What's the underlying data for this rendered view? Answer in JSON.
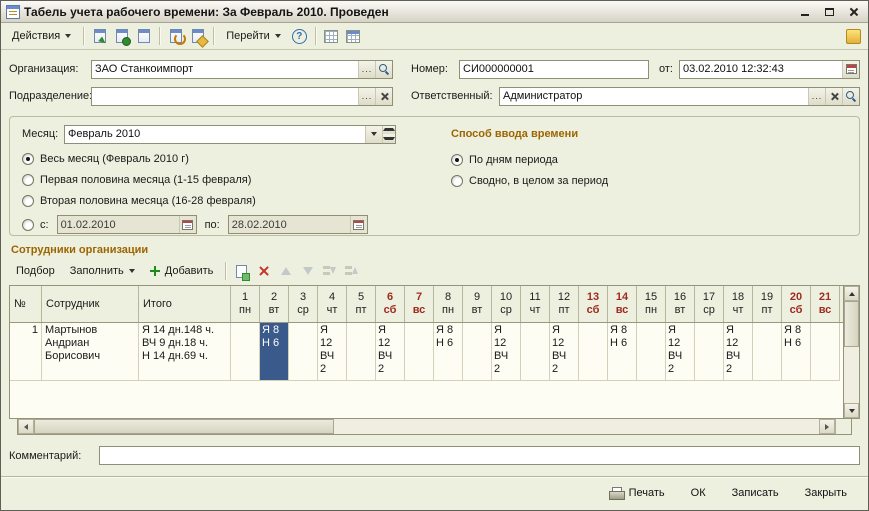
{
  "window": {
    "title": "Табель учета рабочего времени: За Февраль 2010. Проведен"
  },
  "toolbar": {
    "actions_label": "Действия",
    "go_label": "Перейти"
  },
  "glyphs": {
    "help": "?"
  },
  "ui": {
    "ellipsis": "..."
  },
  "fields": {
    "org": {
      "label": "Организация:",
      "value": "ЗАО Станкоимпорт"
    },
    "dept": {
      "label": "Подразделение:",
      "value": ""
    },
    "number": {
      "label": "Номер:",
      "value": "СИ000000001"
    },
    "date": {
      "label": "от:",
      "value": "03.02.2010 12:32:43"
    },
    "responsible": {
      "label": "Ответственный:",
      "value": "Администратор"
    }
  },
  "period": {
    "month": {
      "label": "Месяц:",
      "value": "Февраль 2010"
    },
    "options": [
      {
        "label": "Весь месяц (Февраль 2010 г)",
        "selected": true
      },
      {
        "label": "Первая половина месяца (1-15 февраля)",
        "selected": false
      },
      {
        "label": "Вторая половина месяца (16-28 февраля)",
        "selected": false
      }
    ],
    "range": {
      "from_label": "с:",
      "from_value": "01.02.2010",
      "to_label": "по:",
      "to_value": "28.02.2010",
      "selected": false
    }
  },
  "time_entry": {
    "header": "Способ ввода времени",
    "options": [
      {
        "label": "По дням периода",
        "selected": true
      },
      {
        "label": "Сводно, в целом за период",
        "selected": false
      }
    ]
  },
  "employees": {
    "header": "Сотрудники организации",
    "toolbar": {
      "pick_label": "Подбор",
      "fill_label": "Заполнить",
      "add_label": "Добавить"
    },
    "table": {
      "columns": {
        "num": "№",
        "employee": "Сотрудник",
        "total": "Итого"
      },
      "days": [
        {
          "num": "1",
          "dow": "пн",
          "weekend": false
        },
        {
          "num": "2",
          "dow": "вт",
          "weekend": false
        },
        {
          "num": "3",
          "dow": "ср",
          "weekend": false
        },
        {
          "num": "4",
          "dow": "чт",
          "weekend": false
        },
        {
          "num": "5",
          "dow": "пт",
          "weekend": false
        },
        {
          "num": "6",
          "dow": "сб",
          "weekend": true
        },
        {
          "num": "7",
          "dow": "вс",
          "weekend": true
        },
        {
          "num": "8",
          "dow": "пн",
          "weekend": false
        },
        {
          "num": "9",
          "dow": "вт",
          "weekend": false
        },
        {
          "num": "10",
          "dow": "ср",
          "weekend": false
        },
        {
          "num": "11",
          "dow": "чт",
          "weekend": false
        },
        {
          "num": "12",
          "dow": "пт",
          "weekend": false
        },
        {
          "num": "13",
          "dow": "сб",
          "weekend": true
        },
        {
          "num": "14",
          "dow": "вс",
          "weekend": true
        },
        {
          "num": "15",
          "dow": "пн",
          "weekend": false
        },
        {
          "num": "16",
          "dow": "вт",
          "weekend": false
        },
        {
          "num": "17",
          "dow": "ср",
          "weekend": false
        },
        {
          "num": "18",
          "dow": "чт",
          "weekend": false
        },
        {
          "num": "19",
          "dow": "пт",
          "weekend": false
        },
        {
          "num": "20",
          "dow": "сб",
          "weekend": true
        },
        {
          "num": "21",
          "dow": "вс",
          "weekend": true
        }
      ],
      "rows": [
        {
          "num": "1",
          "employee": "Мартынов\nАндриан\nБорисович",
          "total": "Я 14 дн.148 ч.\nВЧ 9 дн.18 ч.\nН 14 дн.69 ч.",
          "selected_cell_index": 1,
          "cells": [
            "",
            "Я 8\nН 6",
            "",
            "Я\n12\nВЧ\n2",
            "",
            "Я\n12\nВЧ\n2",
            "",
            "Я 8\nН 6",
            "",
            "Я\n12\nВЧ\n2",
            "",
            "Я\n12\nВЧ\n2",
            "",
            "Я 8\nН 6",
            "",
            "Я\n12\nВЧ\n2",
            "",
            "Я\n12\nВЧ\n2",
            "",
            "Я 8\nН 6",
            ""
          ]
        }
      ]
    }
  },
  "comment": {
    "label": "Комментарий:",
    "value": ""
  },
  "footer": {
    "print_label": "Печать",
    "ok_label": "ОК",
    "save_label": "Записать",
    "close_label": "Закрыть"
  },
  "colors": {
    "selection_bg": "#3a5a8c",
    "weekend_text": "#9e2b20",
    "section_header": "#9c6500",
    "form_bg": "#eef0df"
  }
}
